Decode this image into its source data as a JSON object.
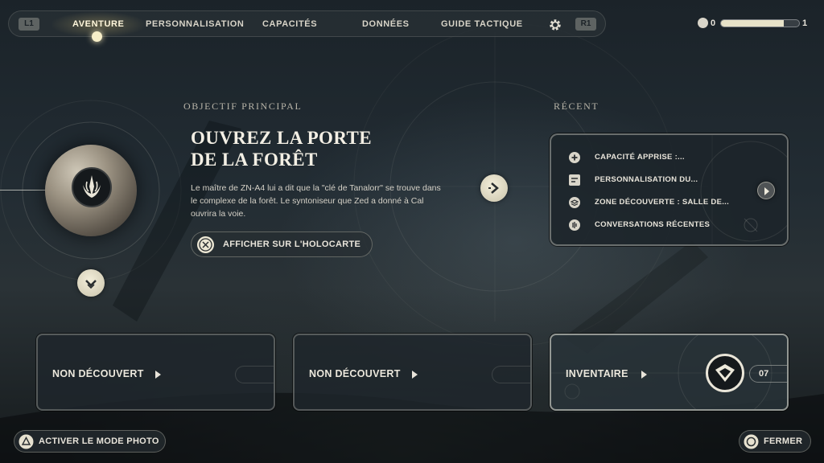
{
  "nav": {
    "left_shoulder": "L1",
    "right_shoulder": "R1",
    "tabs": [
      {
        "label": "AVENTURE",
        "active": true
      },
      {
        "label": "PERSONNALISATION",
        "active": false
      },
      {
        "label": "CAPACITÉS",
        "active": false
      },
      {
        "label": "DONNÉES",
        "active": false
      },
      {
        "label": "GUIDE TACTIQUE",
        "active": false
      }
    ],
    "settings_icon": "gear-icon"
  },
  "status": {
    "points": "0",
    "level": "1",
    "xp_progress": 0.8,
    "points_icon": "skill-point-icon"
  },
  "objective": {
    "section_label": "OBJECTIF PRINCIPAL",
    "title_line1": "OUVREZ LA PORTE",
    "title_line2": "DE LA FORÊT",
    "description": "Le maître de ZN-A4 lui a dit que la \"clé de Tanalorr\" se trouve dans le complexe de la forêt. Le syntoniseur que Zed a donné à Cal ouvrira la voie.",
    "holomap_button": "AFFICHER SUR L'HOLOCARTE",
    "holomap_icon": "cross-button-icon"
  },
  "recent": {
    "section_label": "RÉCENT",
    "items": [
      {
        "label": "CAPACITÉ APPRISE :...",
        "icon": "plus-icon"
      },
      {
        "label": "PERSONNALISATION DU...",
        "icon": "customization-icon"
      },
      {
        "label": "ZONE DÉCOUVERTE : SALLE DE...",
        "icon": "layers-icon"
      },
      {
        "label": "CONVERSATIONS RÉCENTES",
        "icon": "audio-icon"
      }
    ]
  },
  "cards": [
    {
      "label": "NON DÉCOUVERT"
    },
    {
      "label": "NON DÉCOUVERT"
    },
    {
      "label": "INVENTAIRE",
      "count": "07"
    }
  ],
  "footer": {
    "photo_mode": "ACTIVER LE MODE PHOTO",
    "photo_icon": "triangle-button-icon",
    "close": "FERMER",
    "close_icon": "circle-button-icon"
  },
  "colors": {
    "accent": "#f3eeda",
    "panel_border": "#c8c8be",
    "background": "#1f282e"
  }
}
